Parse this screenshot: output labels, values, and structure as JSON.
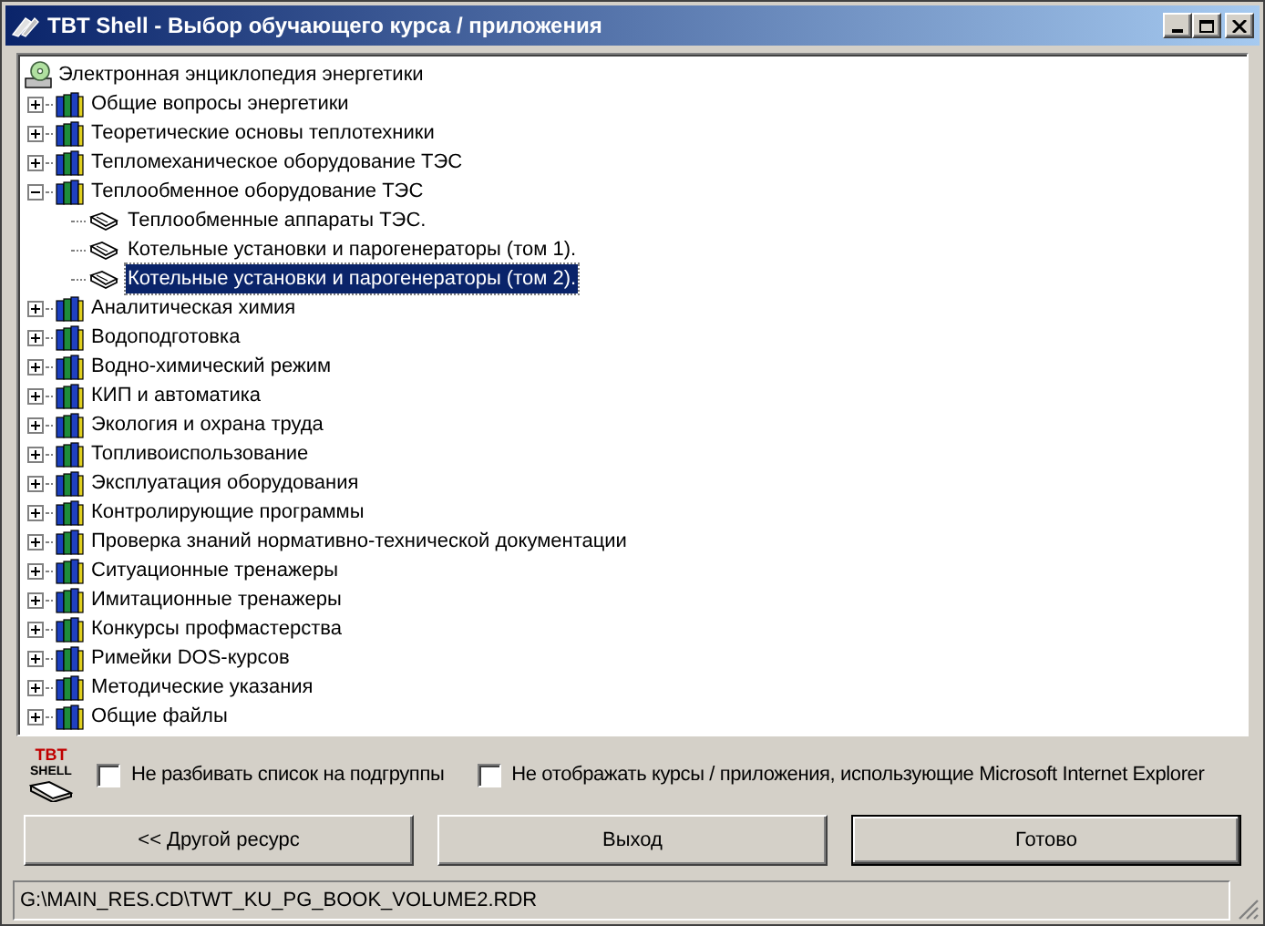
{
  "window": {
    "title": "TBT Shell - Выбор обучающего курса / приложения"
  },
  "tree": {
    "label": "Электронная энциклопедия энергетики",
    "children": [
      {
        "label": "Общие вопросы энергетики",
        "expanded": false
      },
      {
        "label": "Теоретические основы теплотехники",
        "expanded": false
      },
      {
        "label": "Тепломеханическое оборудование ТЭС",
        "expanded": false
      },
      {
        "label": "Теплообменное оборудование ТЭС",
        "expanded": true,
        "children": [
          {
            "label": "Теплообменные аппараты ТЭС.",
            "selected": false
          },
          {
            "label": "Котельные установки и парогенераторы (том 1).",
            "selected": false
          },
          {
            "label": "Котельные установки и парогенераторы (том 2).",
            "selected": true
          }
        ]
      },
      {
        "label": "Аналитическая химия",
        "expanded": false
      },
      {
        "label": "Водоподготовка",
        "expanded": false
      },
      {
        "label": "Водно-химический режим",
        "expanded": false
      },
      {
        "label": "КИП и автоматика",
        "expanded": false
      },
      {
        "label": "Экология и охрана труда",
        "expanded": false
      },
      {
        "label": "Топливоиспользование",
        "expanded": false
      },
      {
        "label": "Эксплуатация оборудования",
        "expanded": false
      },
      {
        "label": "Контролирующие программы",
        "expanded": false
      },
      {
        "label": "Проверка знаний нормативно-технической документации",
        "expanded": false
      },
      {
        "label": "Ситуационные тренажеры",
        "expanded": false
      },
      {
        "label": "Имитационные тренажеры",
        "expanded": false
      },
      {
        "label": "Конкурсы профмастерства",
        "expanded": false
      },
      {
        "label": "Римейки DOS-курсов",
        "expanded": false
      },
      {
        "label": "Методические указания",
        "expanded": false
      },
      {
        "label": "Общие файлы",
        "expanded": false
      }
    ]
  },
  "logo": {
    "line1": "TBT",
    "line2": "SHELL"
  },
  "options": [
    {
      "label": "Не разбивать список на подгруппы",
      "checked": false
    },
    {
      "label": "Не отображать курсы / приложения, использующие Microsoft Internet Explorer",
      "checked": false
    }
  ],
  "buttons": [
    {
      "label": "<< Другой ресурс",
      "default": false
    },
    {
      "label": "Выход",
      "default": false
    },
    {
      "label": "Готово",
      "default": true
    }
  ],
  "status_bar": "G:\\MAIN_RES.CD\\TWT_KU_PG_BOOK_VOLUME2.RDR"
}
